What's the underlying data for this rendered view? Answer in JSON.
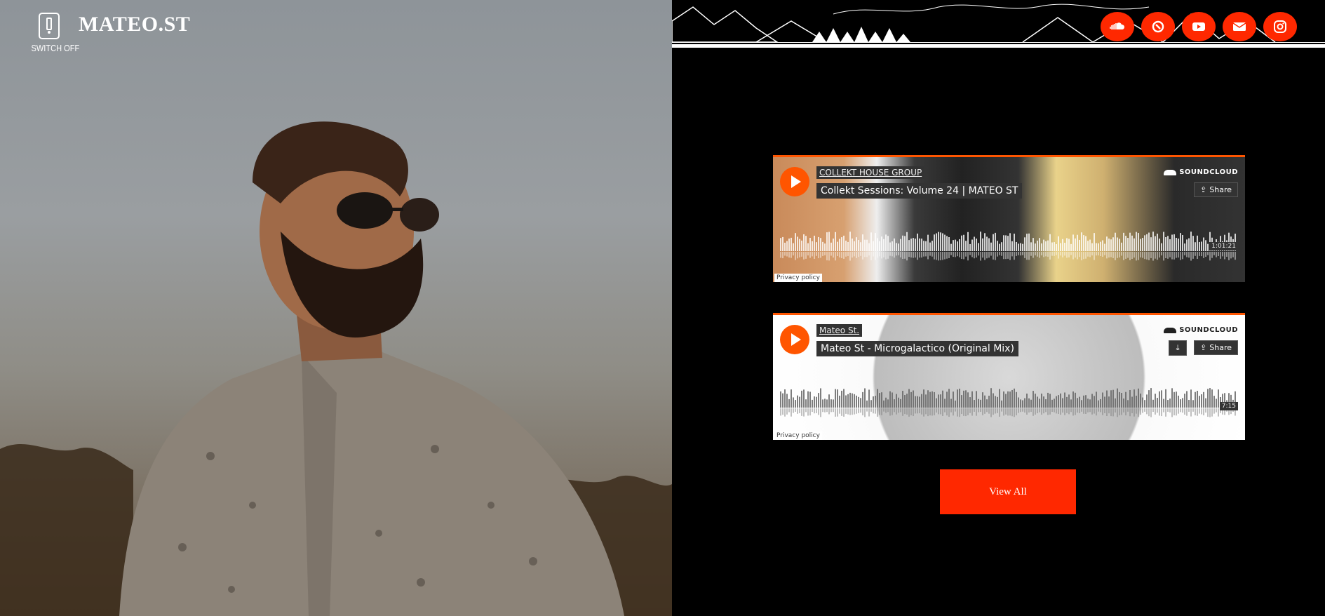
{
  "brand": {
    "logo": "MATEO.ST",
    "switch_label": "SWITCH OFF"
  },
  "social": [
    {
      "name": "soundcloud"
    },
    {
      "name": "beatport"
    },
    {
      "name": "youtube"
    },
    {
      "name": "email"
    },
    {
      "name": "instagram"
    }
  ],
  "players": [
    {
      "artist": "COLLEKT HOUSE GROUP",
      "title": "Collekt Sessions: Volume 24 | MATEO ST",
      "duration": "1:01:21",
      "soundcloud_label": "SOUNDCLOUD",
      "share_label": "Share",
      "privacy_label": "Privacy policy"
    },
    {
      "artist": "Mateo St.",
      "title": "Mateo St - Microgalactico (Original Mix)",
      "duration": "7:15",
      "soundcloud_label": "SOUNDCLOUD",
      "share_label": "Share",
      "privacy_label": "Privacy policy"
    }
  ],
  "view_all_label": "View All",
  "colors": {
    "accent": "#ff2800",
    "soundcloud_orange": "#ff5500",
    "background": "#000000"
  }
}
